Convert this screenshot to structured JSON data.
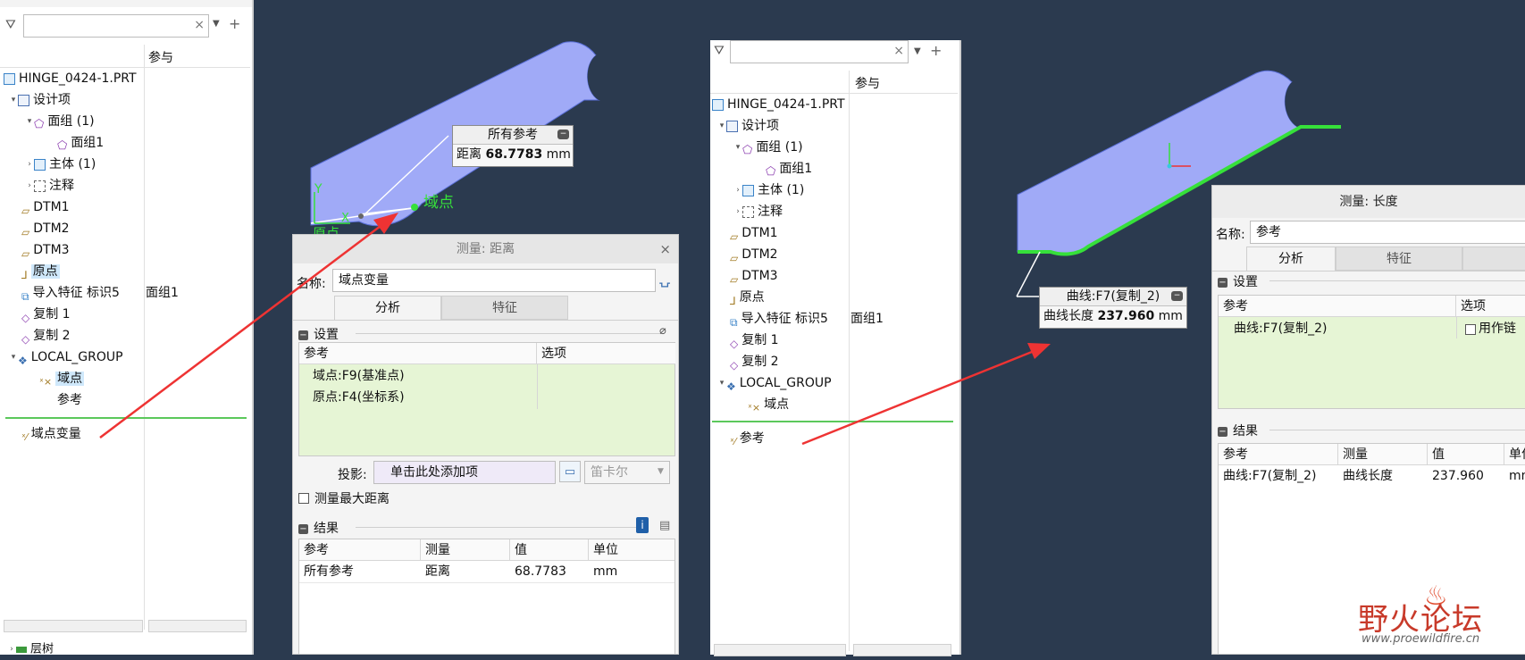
{
  "left_tree": {
    "search_placeholder": "",
    "column_header": "参与",
    "items": [
      {
        "label": "HINGE_0424-1.PRT",
        "col2": ""
      },
      {
        "label": "设计项",
        "col2": ""
      },
      {
        "label": "面组 (1)",
        "col2": ""
      },
      {
        "label": "面组1",
        "col2": ""
      },
      {
        "label": "主体 (1)",
        "col2": ""
      },
      {
        "label": "注释",
        "col2": ""
      },
      {
        "label": "DTM1",
        "col2": ""
      },
      {
        "label": "DTM2",
        "col2": ""
      },
      {
        "label": "DTM3",
        "col2": ""
      },
      {
        "label": "原点",
        "col2": ""
      },
      {
        "label": "导入特征 标识5",
        "col2": "面组1"
      },
      {
        "label": "复制 1",
        "col2": ""
      },
      {
        "label": "复制 2",
        "col2": ""
      },
      {
        "label": "LOCAL_GROUP",
        "col2": ""
      },
      {
        "label": "域点",
        "col2": ""
      },
      {
        "label": "参考",
        "col2": ""
      },
      {
        "label": "域点变量",
        "col2": ""
      }
    ],
    "bottom_label": "层树"
  },
  "right_tree": {
    "column_header": "参与",
    "items": [
      {
        "label": "HINGE_0424-1.PRT",
        "col2": ""
      },
      {
        "label": "设计项",
        "col2": ""
      },
      {
        "label": "面组 (1)",
        "col2": ""
      },
      {
        "label": "面组1",
        "col2": ""
      },
      {
        "label": "主体 (1)",
        "col2": ""
      },
      {
        "label": "注释",
        "col2": ""
      },
      {
        "label": "DTM1",
        "col2": ""
      },
      {
        "label": "DTM2",
        "col2": ""
      },
      {
        "label": "DTM3",
        "col2": ""
      },
      {
        "label": "原点",
        "col2": ""
      },
      {
        "label": "导入特征 标识5",
        "col2": "面组1"
      },
      {
        "label": "复制 1",
        "col2": ""
      },
      {
        "label": "复制 2",
        "col2": ""
      },
      {
        "label": "LOCAL_GROUP",
        "col2": ""
      },
      {
        "label": "域点",
        "col2": ""
      },
      {
        "label": "参考",
        "col2": ""
      }
    ]
  },
  "viewport_left": {
    "callout_title": "所有参考",
    "callout_label": "距离",
    "callout_value": "68.7783",
    "callout_unit": "mm",
    "point_label": "域点",
    "origin_label": "原点",
    "axis_y": "Y",
    "axis_x": "X"
  },
  "dialog_distance": {
    "title": "测量: 距离",
    "name_label": "名称:",
    "name_value": "域点变量",
    "tab_analysis": "分析",
    "tab_feature": "特征",
    "settings_label": "设置",
    "col_ref": "参考",
    "col_option": "选项",
    "refs": [
      "域点:F9(基准点)",
      "原点:F4(坐标系)"
    ],
    "projection_label": "投影:",
    "projection_placeholder": "单击此处添加项",
    "coord_select": "笛卡尔",
    "max_distance_label": "测量最大距离",
    "results_label": "结果",
    "result_headers": [
      "参考",
      "测量",
      "值",
      "单位"
    ],
    "result_rows": [
      [
        "所有参考",
        "距离",
        "68.7783",
        "mm"
      ]
    ]
  },
  "viewport_right": {
    "callout_title": "曲线:F7(复制_2)",
    "callout_label": "曲线长度",
    "callout_value": "237.960",
    "callout_unit": "mm"
  },
  "dialog_length": {
    "title": "测量: 长度",
    "name_label": "名称:",
    "name_value": "参考",
    "tab_analysis": "分析",
    "tab_feature": "特征",
    "settings_label": "设置",
    "col_ref": "参考",
    "col_option": "选项",
    "ref": "曲线:F7(复制_2)",
    "chain_option": "用作链",
    "results_label": "结果",
    "result_headers": [
      "参考",
      "测量",
      "值",
      "单位"
    ],
    "result_rows": [
      [
        "曲线:F7(复制_2)",
        "曲线长度",
        "237.960",
        "mm"
      ]
    ]
  },
  "watermark": {
    "title": "野火论坛",
    "url": "www.proewildfire.cn"
  },
  "colors": {
    "viewport_bg": "#2b3a4f",
    "part_fill": "#a0aaf7",
    "highlight_green": "#36e03a",
    "arrow_red": "#ee3333",
    "row_green": "#e6f5d5"
  }
}
